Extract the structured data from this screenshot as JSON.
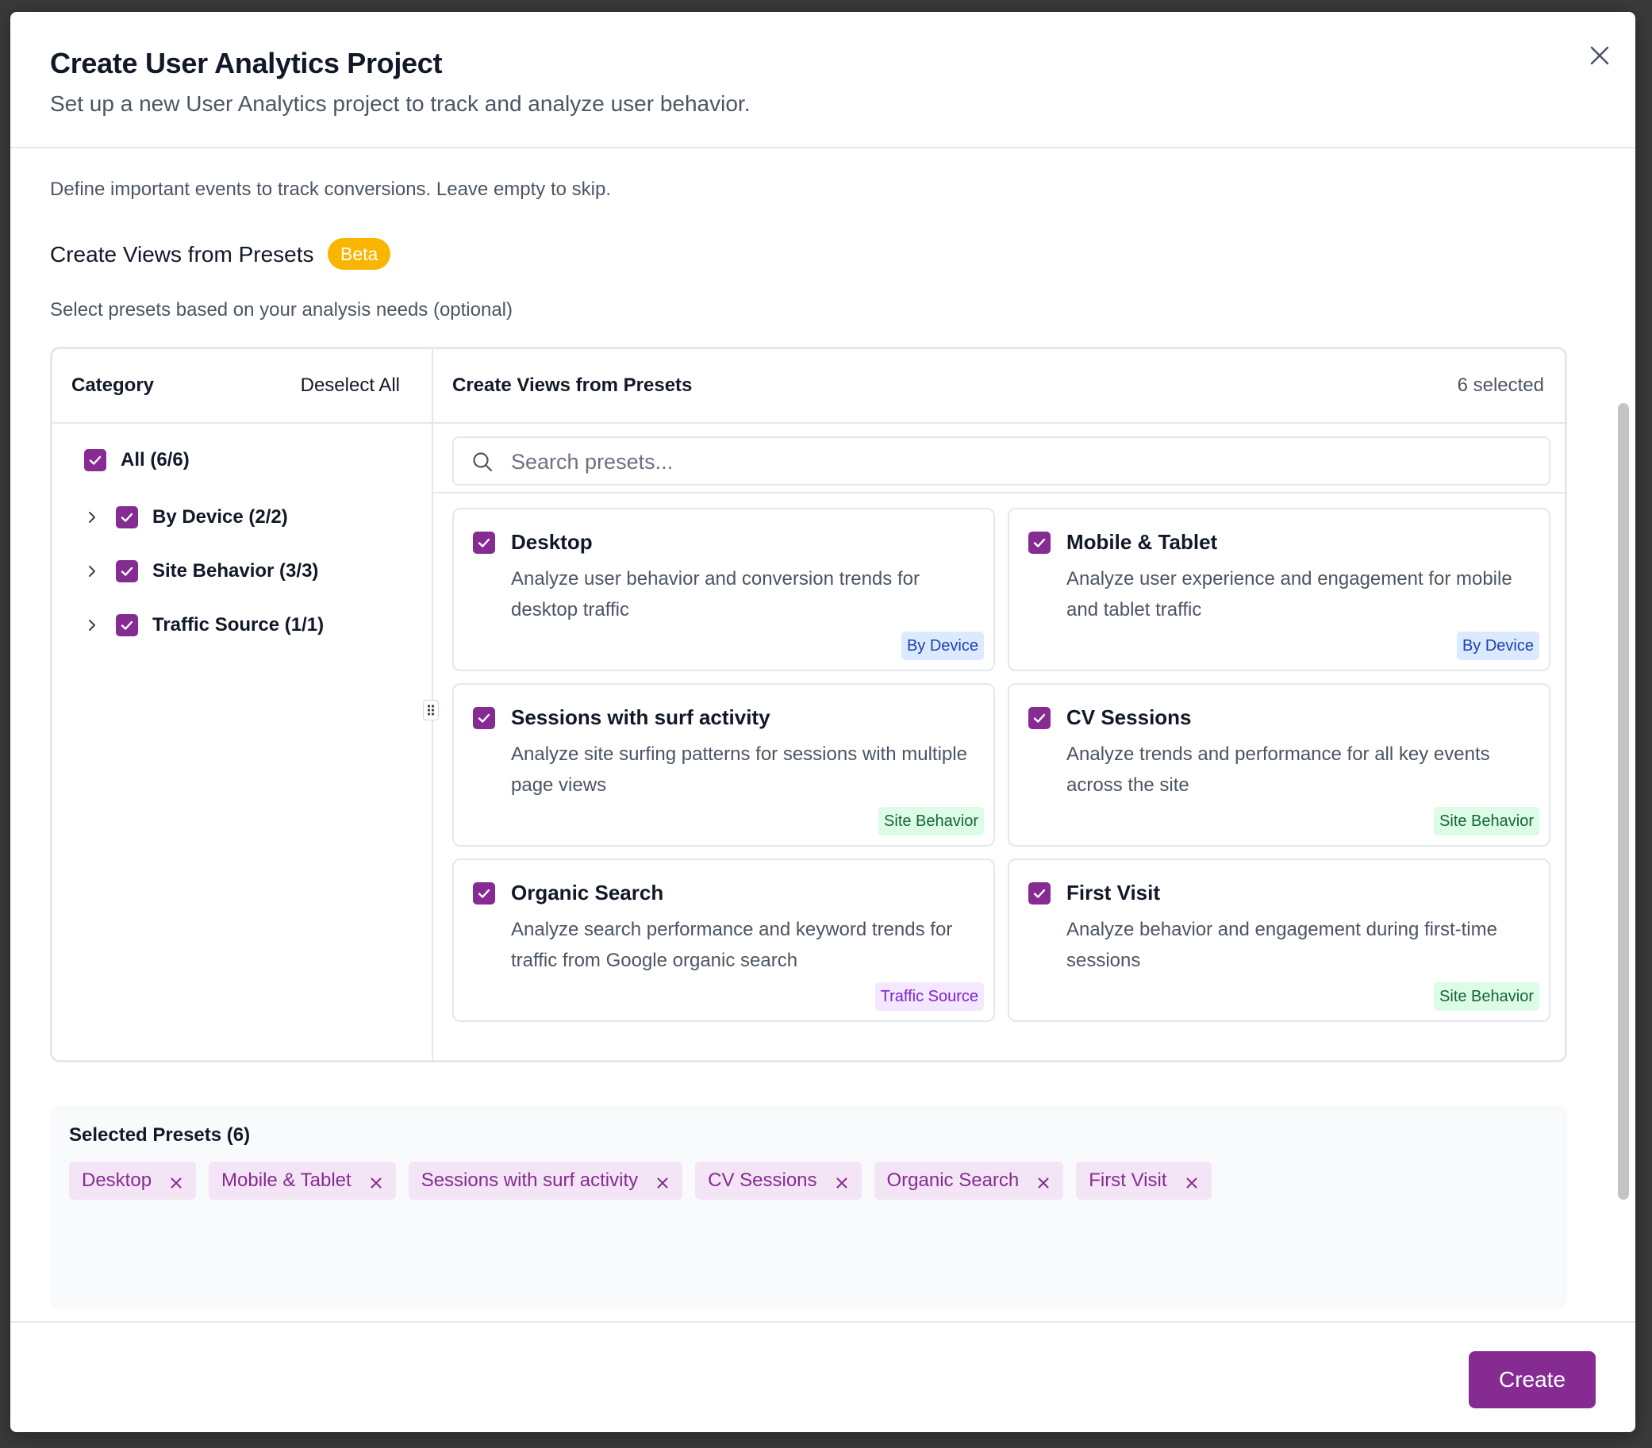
{
  "modal": {
    "title": "Create User Analytics Project",
    "subtitle": "Set up a new User Analytics project to track and analyze user behavior."
  },
  "body": {
    "intro": "Define important events to track conversions. Leave empty to skip.",
    "section_title": "Create Views from Presets",
    "beta_label": "Beta",
    "section_desc": "Select presets based on your analysis needs (optional)"
  },
  "category_panel": {
    "header": "Category",
    "deselect_label": "Deselect All",
    "items": [
      {
        "label": "All (6/6)",
        "checked": true
      },
      {
        "label": "By Device (2/2)",
        "checked": true
      },
      {
        "label": "Site Behavior (3/3)",
        "checked": true
      },
      {
        "label": "Traffic Source (1/1)",
        "checked": true
      }
    ]
  },
  "presets_panel": {
    "header": "Create Views from Presets",
    "selected_count": "6 selected",
    "search_placeholder": "Search presets...",
    "cards": [
      {
        "title": "Desktop",
        "desc": "Analyze user behavior and conversion trends for desktop traffic",
        "tag": "By Device",
        "checked": true
      },
      {
        "title": "Mobile & Tablet",
        "desc": "Analyze user experience and engagement for mobile and tablet traffic",
        "tag": "By Device",
        "checked": true
      },
      {
        "title": "Sessions with surf activity",
        "desc": "Analyze site surfing patterns for sessions with multiple page views",
        "tag": "Site Behavior",
        "checked": true
      },
      {
        "title": "CV Sessions",
        "desc": "Analyze trends and performance for all key events across the site",
        "tag": "Site Behavior",
        "checked": true
      },
      {
        "title": "Organic Search",
        "desc": "Analyze search performance and keyword trends for traffic from Google organic search",
        "tag": "Traffic Source",
        "checked": true
      },
      {
        "title": "First Visit",
        "desc": "Analyze behavior and engagement during first-time sessions",
        "tag": "Site Behavior",
        "checked": true
      }
    ]
  },
  "selected": {
    "title": "Selected Presets (6)",
    "chips": [
      "Desktop",
      "Mobile & Tablet",
      "Sessions with surf activity",
      "CV Sessions",
      "Organic Search",
      "First Visit"
    ]
  },
  "footer": {
    "create_label": "Create"
  },
  "colors": {
    "accent": "#862b92",
    "beta": "#f9b500",
    "tag_device_bg": "#dbeafe",
    "tag_site_bg": "#dcfce7",
    "tag_traffic_bg": "#f3e8ff"
  }
}
